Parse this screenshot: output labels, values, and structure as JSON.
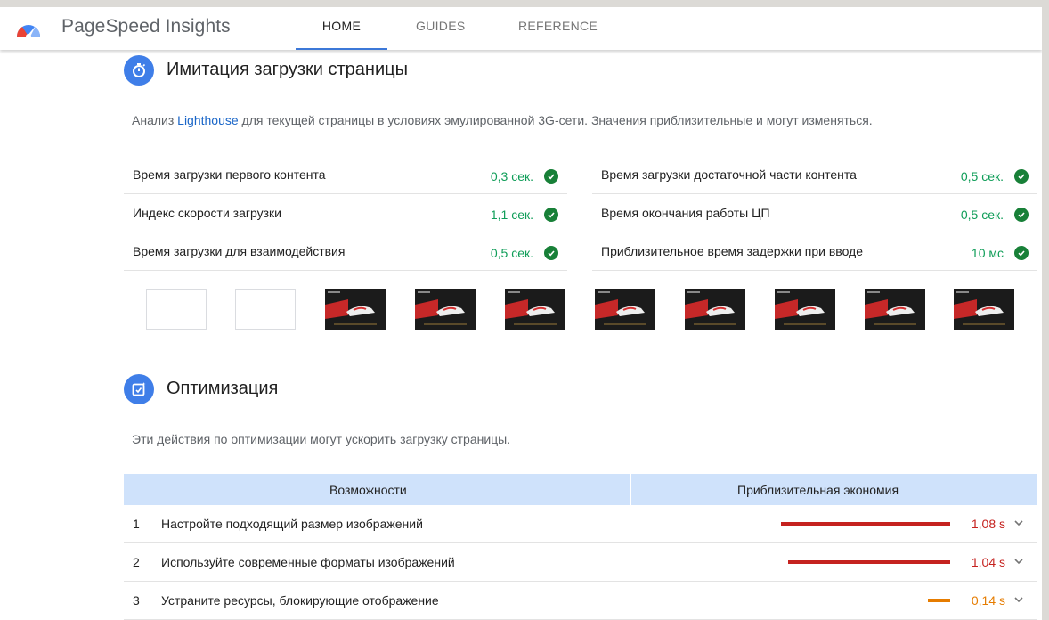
{
  "header": {
    "brand": "PageSpeed Insights",
    "tabs": [
      {
        "label": "HOME",
        "active": true
      },
      {
        "label": "GUIDES",
        "active": false
      },
      {
        "label": "REFERENCE",
        "active": false
      }
    ]
  },
  "lab": {
    "title": "Имитация загрузки страницы",
    "icon": "stopwatch-icon",
    "desc_prefix": "Анализ ",
    "desc_link": "Lighthouse",
    "desc_suffix": " для текущей страницы в условиях эмулированной 3G-сети. Значения приблизительные и могут изменяться.",
    "metrics": [
      {
        "label": "Время загрузки первого контента",
        "value": "0,3 сек."
      },
      {
        "label": "Время загрузки достаточной части контента",
        "value": "0,5 сек."
      },
      {
        "label": "Индекс скорости загрузки",
        "value": "1,1 сек."
      },
      {
        "label": "Время окончания работы ЦП",
        "value": "0,5 сек."
      },
      {
        "label": "Время загрузки для взаимодействия",
        "value": "0,5 сек."
      },
      {
        "label": "Приблизительное время задержки при вводе",
        "value": "10 мс"
      }
    ],
    "filmstrip": {
      "blank_frames": 2,
      "loaded_frames": 8
    }
  },
  "opt": {
    "title": "Оптимизация",
    "icon": "optimization-icon",
    "desc": "Эти действия по оптимизации могут ускорить загрузку страницы.",
    "col_opportunity": "Возможности",
    "col_savings": "Приблизительная экономия",
    "rows": [
      {
        "num": "1",
        "label": "Настройте подходящий размер изображений",
        "value": "1,08 s",
        "level": "slow",
        "savings_fraction": 1.0
      },
      {
        "num": "2",
        "label": "Используйте современные форматы изображений",
        "value": "1,04 s",
        "level": "slow",
        "savings_fraction": 0.96
      },
      {
        "num": "3",
        "label": "Устраните ресурсы, блокирующие отображение",
        "value": "0,14 s",
        "level": "average",
        "savings_fraction": 0.13
      }
    ]
  },
  "colors": {
    "accent": "#3c78d8",
    "pass": "#0f9d58",
    "fail": "#c5221f",
    "average": "#e67c00",
    "table_header": "#cfe2fb"
  }
}
